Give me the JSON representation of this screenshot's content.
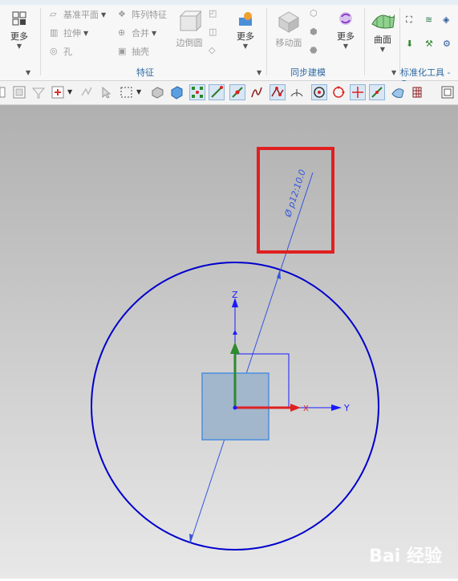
{
  "ribbon": {
    "more_label_1": "更多",
    "datum_plane": "基准平面",
    "pattern_feature": "阵列特征",
    "extrude": "拉伸",
    "unite": "合并",
    "hole": "孔",
    "shell": "抽壳",
    "edge_blend": "边倒圆",
    "more_label_2": "更多",
    "move_face": "移动面",
    "more_label_3": "更多",
    "surface": "曲面",
    "group_feature": "特征",
    "group_sync": "同步建模",
    "group_std": "标准化工具 - G"
  },
  "viewport": {
    "dimension_label": "Ø p12:10.0",
    "axis_z": "Z",
    "axis_y": "Y",
    "axis_x": "X",
    "watermark": "Bai 经验"
  },
  "colors": {
    "circle": "#0000cc",
    "highlight_box": "#e02020",
    "axis_y_blue": "#1a1aff",
    "axis_green": "#2e8b2e",
    "axis_red": "#dd2222"
  }
}
